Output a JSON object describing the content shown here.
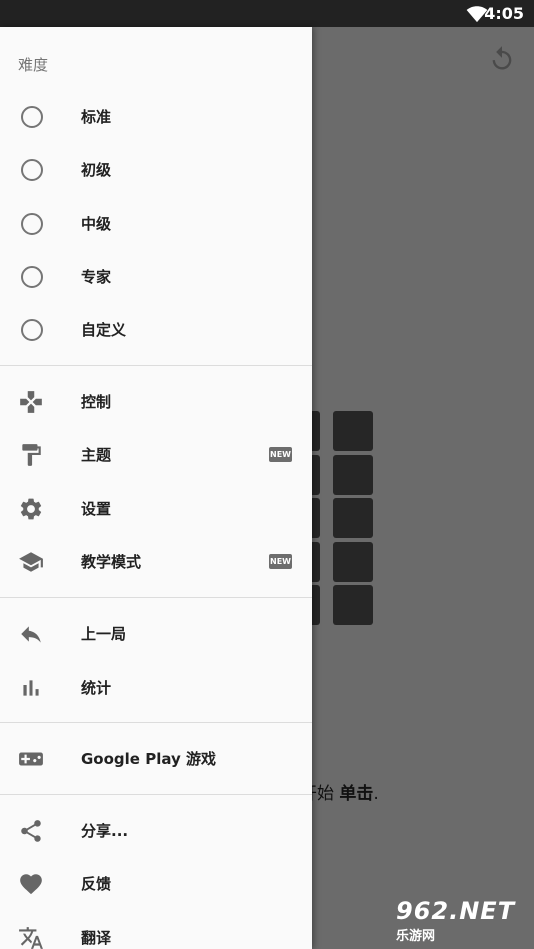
{
  "status_bar": {
    "time": "4:05"
  },
  "game": {
    "hint_prefix": "开始",
    "hint_bold": "单击",
    "hint_suffix": "."
  },
  "watermark": {
    "brand": "962.NET",
    "sub": "乐游网"
  },
  "drawer": {
    "difficulty_title": "难度",
    "difficulty_options": [
      {
        "label": "标准"
      },
      {
        "label": "初级"
      },
      {
        "label": "中级"
      },
      {
        "label": "专家"
      },
      {
        "label": "自定义"
      }
    ],
    "menu_group_1": [
      {
        "label": "控制",
        "icon": "gamepad-cross-icon"
      },
      {
        "label": "主题",
        "icon": "paint-roller-icon",
        "badge": "NEW"
      },
      {
        "label": "设置",
        "icon": "gear-icon"
      },
      {
        "label": "教学模式",
        "icon": "graduation-cap-icon",
        "badge": "NEW"
      }
    ],
    "menu_group_2": [
      {
        "label": "上一局",
        "icon": "reply-icon"
      },
      {
        "label": "统计",
        "icon": "bar-chart-icon"
      }
    ],
    "menu_group_3": [
      {
        "label": "Google Play 游戏",
        "icon": "controller-icon"
      }
    ],
    "menu_group_4": [
      {
        "label": "分享...",
        "icon": "share-icon"
      },
      {
        "label": "反馈",
        "icon": "heart-icon"
      },
      {
        "label": "翻译",
        "icon": "translate-icon"
      }
    ]
  },
  "colors": {
    "drawer_bg": "#fafafa",
    "scrim": "#6b6b6b",
    "cell": "#262626",
    "icon": "#666666",
    "badge": "#6d6d6d"
  }
}
